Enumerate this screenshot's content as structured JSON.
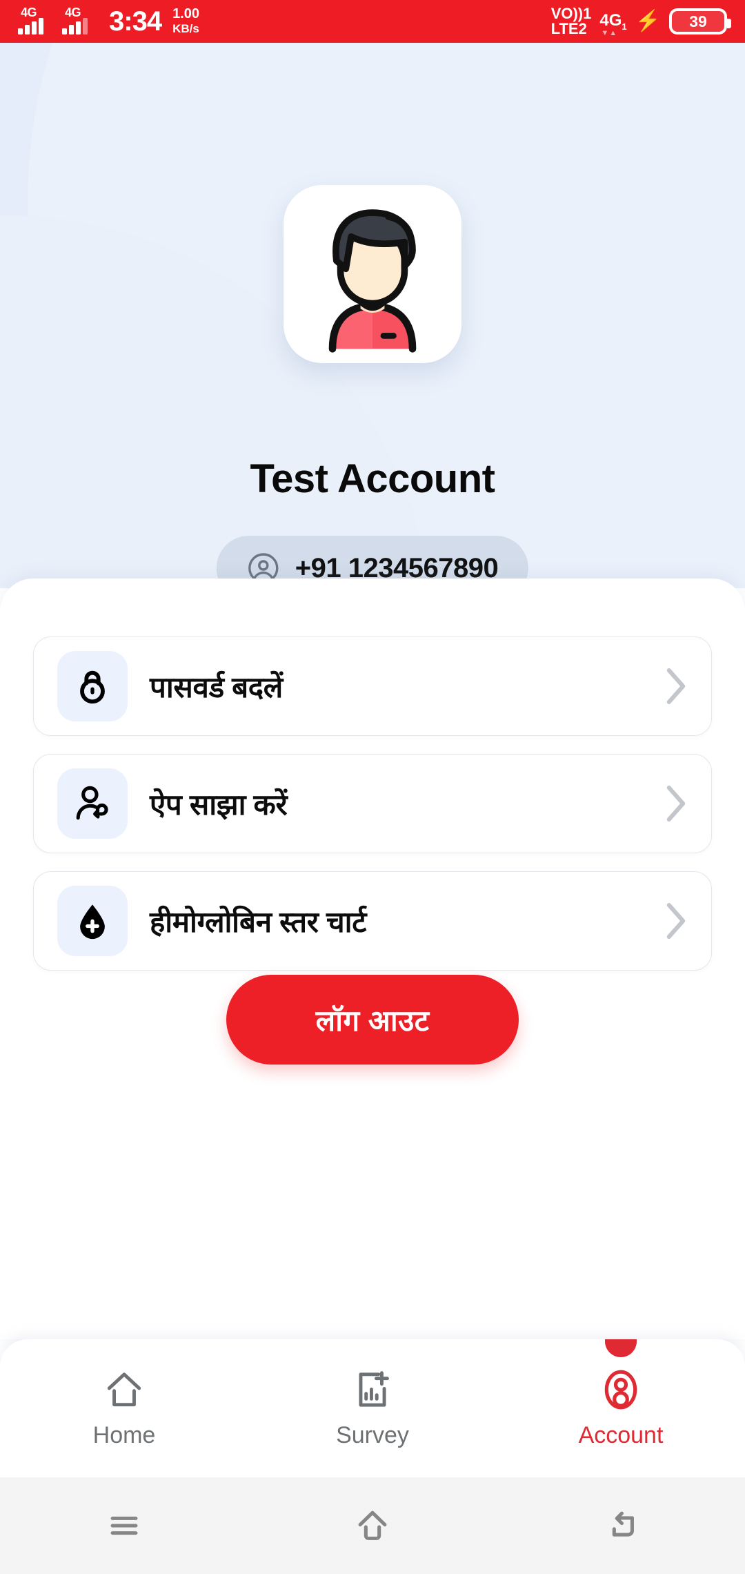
{
  "status_bar": {
    "background_color": "#EE1C25",
    "signal_1_label": "4G",
    "signal_2_label": "4G",
    "clock": "3:34",
    "net_speed_value": "1.00",
    "net_speed_unit": "KB/s",
    "volte_line1": "VO))",
    "volte_sim1": "1",
    "volte_line2": "LTE2",
    "data_network": "4G",
    "data_network_sim": "1",
    "charging_icon": "bolt-icon",
    "battery_percent": "39"
  },
  "header": {
    "background_color": "#E4EDF9",
    "avatar_icon": "user-avatar-illustration",
    "profile_name": "Test Account",
    "phone_icon": "person-circle-icon",
    "phone_number": "+91 1234567890"
  },
  "menu": {
    "items": [
      {
        "icon": "lock-icon",
        "label": "पासवर्ड बदलें",
        "chevron": "chevron-right-icon"
      },
      {
        "icon": "share-user-icon",
        "label": "ऐप साझा करें",
        "chevron": "chevron-right-icon"
      },
      {
        "icon": "blood-drop-icon",
        "label": "हीमोग्लोबिन स्तर चार्ट",
        "chevron": "chevron-right-icon"
      }
    ]
  },
  "logout": {
    "label": "लॉग आउट",
    "color": "#EE2027"
  },
  "bottom_nav": {
    "active_color": "#E02A33",
    "inactive_color": "#6E7173",
    "items": [
      {
        "icon": "home-icon",
        "label": "Home",
        "active": false
      },
      {
        "icon": "survey-chart-icon",
        "label": "Survey",
        "active": false
      },
      {
        "icon": "account-icon",
        "label": "Account",
        "active": true
      }
    ]
  },
  "system_nav": {
    "recents_icon": "menu-lines-icon",
    "home_icon": "home-outline-icon",
    "back_icon": "back-arrow-icon"
  }
}
